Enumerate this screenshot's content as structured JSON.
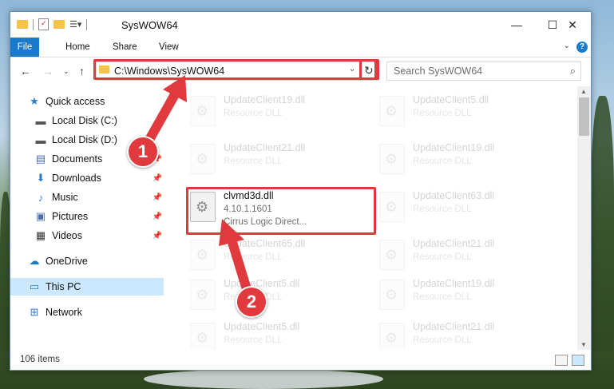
{
  "window": {
    "title": "SysWOW64",
    "controls": {
      "minimize": "—",
      "maximize": "☐",
      "close": "✕"
    }
  },
  "ribbon": {
    "tabs": [
      {
        "label": "File"
      },
      {
        "label": "Home"
      },
      {
        "label": "Share"
      },
      {
        "label": "View"
      }
    ]
  },
  "address_bar": {
    "path": "C:\\Windows\\SysWOW64",
    "search_placeholder": "Search SysWOW64"
  },
  "sidebar": {
    "items": [
      {
        "label": "Quick access",
        "icon": "star-icon"
      },
      {
        "label": "Local Disk (C:)",
        "icon": "drive-icon",
        "pinned": true
      },
      {
        "label": "Local Disk (D:)",
        "icon": "drive-icon",
        "pinned": true
      },
      {
        "label": "Documents",
        "icon": "documents-icon",
        "pinned": true
      },
      {
        "label": "Downloads",
        "icon": "downloads-icon",
        "pinned": true
      },
      {
        "label": "Music",
        "icon": "music-icon",
        "pinned": true
      },
      {
        "label": "Pictures",
        "icon": "pictures-icon",
        "pinned": true
      },
      {
        "label": "Videos",
        "icon": "videos-icon",
        "pinned": true
      },
      {
        "label": "OneDrive",
        "icon": "cloud-icon"
      },
      {
        "label": "This PC",
        "icon": "computer-icon",
        "selected": true
      },
      {
        "label": "Network",
        "icon": "network-icon"
      }
    ]
  },
  "files": [
    {
      "name": "UpdateClient19.dll",
      "type": "Resource DLL",
      "focus": false
    },
    {
      "name": "UpdateClient5.dll",
      "type": "Resource DLL",
      "focus": false
    },
    {
      "name": "UpdateClient21.dll",
      "type": "Resource DLL",
      "focus": false
    },
    {
      "name": "UpdateClient19.dll",
      "type": "Resource DLL",
      "focus": false
    },
    {
      "name": "clvmd3d.dll",
      "type": "4.10.1.1601",
      "desc": "Cirrus Logic Direct...",
      "focus": true
    },
    {
      "name": "UpdateClient63.dll",
      "type": "Resource DLL",
      "focus": false
    },
    {
      "name": "UpdateClient65.dll",
      "type": "Resource DLL",
      "focus": false
    },
    {
      "name": "UpdateClient21.dll",
      "type": "Resource DLL",
      "focus": false
    },
    {
      "name": "UpdateClient5.dll",
      "type": "Resource DLL",
      "focus": false
    },
    {
      "name": "UpdateClient19.dll",
      "type": "Resource DLL",
      "focus": false
    },
    {
      "name": "UpdateClient5.dll",
      "type": "Resource DLL",
      "focus": false
    },
    {
      "name": "UpdateClient21.dll",
      "type": "Resource DLL",
      "focus": false
    }
  ],
  "status": {
    "item_count": "106 items"
  },
  "annotations": {
    "step1": "1",
    "step2": "2",
    "accent_color": "#e0393e"
  }
}
